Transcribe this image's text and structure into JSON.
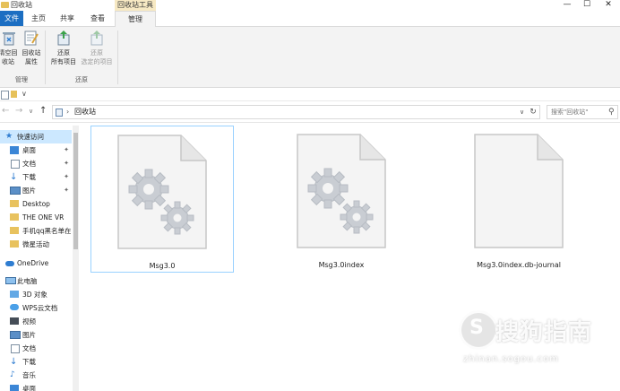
{
  "window": {
    "title": "回收站",
    "context_tab_label": "回收站工具",
    "buttons": {
      "minimize": "—",
      "maximize": "☐",
      "close": "✕"
    }
  },
  "ribbon": {
    "tabs": [
      {
        "label": "文件"
      },
      {
        "label": "主页"
      },
      {
        "label": "共享"
      },
      {
        "label": "查看"
      },
      {
        "label": "管理"
      }
    ],
    "groups": [
      {
        "label": "管理",
        "buttons": [
          {
            "label1": "清空回",
            "label2": "收站"
          },
          {
            "label1": "回收站",
            "label2": "属性"
          }
        ]
      },
      {
        "label": "还原",
        "buttons": [
          {
            "label1": "还原",
            "label2": "所有项目"
          },
          {
            "label1": "还原",
            "label2": "选定的项目"
          }
        ]
      }
    ]
  },
  "qat": {
    "dropdown": "∨"
  },
  "address": {
    "nav": {
      "back": "←",
      "forward": "→",
      "recent": "∨",
      "up": "↑"
    },
    "separator": "›",
    "path": "回收站",
    "dropdown": "∨",
    "refresh": "↻",
    "search_placeholder": "搜索\"回收站\"",
    "search_icon": "⚲"
  },
  "nav_pane": {
    "items": [
      {
        "label": "快速访问",
        "icon": "star-icon"
      },
      {
        "label": "桌面",
        "pinned": true
      },
      {
        "label": "文档",
        "pinned": true
      },
      {
        "label": "下载",
        "pinned": true
      },
      {
        "label": "图片",
        "pinned": true
      },
      {
        "label": "Desktop"
      },
      {
        "label": "THE ONE VR"
      },
      {
        "label": "手机qq黑名单在"
      },
      {
        "label": "微星活动"
      },
      {
        "label": "OneDrive"
      },
      {
        "label": "此电脑"
      },
      {
        "label": "3D 对象"
      },
      {
        "label": "WPS云文档"
      },
      {
        "label": "视频"
      },
      {
        "label": "图片"
      },
      {
        "label": "文档"
      },
      {
        "label": "下载"
      },
      {
        "label": "音乐"
      },
      {
        "label": "桌面"
      }
    ],
    "pin_glyph": "✦"
  },
  "files": [
    {
      "name": "Msg3.0",
      "icon": "gear-file-icon",
      "selected": true
    },
    {
      "name": "Msg3.0index",
      "icon": "gear-file-icon",
      "selected": false
    },
    {
      "name": "Msg3.0index.db-journal",
      "icon": "blank-file-icon",
      "selected": false
    }
  ],
  "watermark": {
    "brand": "搜狗指南",
    "url": "zhinan.sogou.com"
  },
  "colors": {
    "accent": "#1c6ec2",
    "context_tab": "#f7e9c3",
    "selection": "#cce8ff"
  }
}
